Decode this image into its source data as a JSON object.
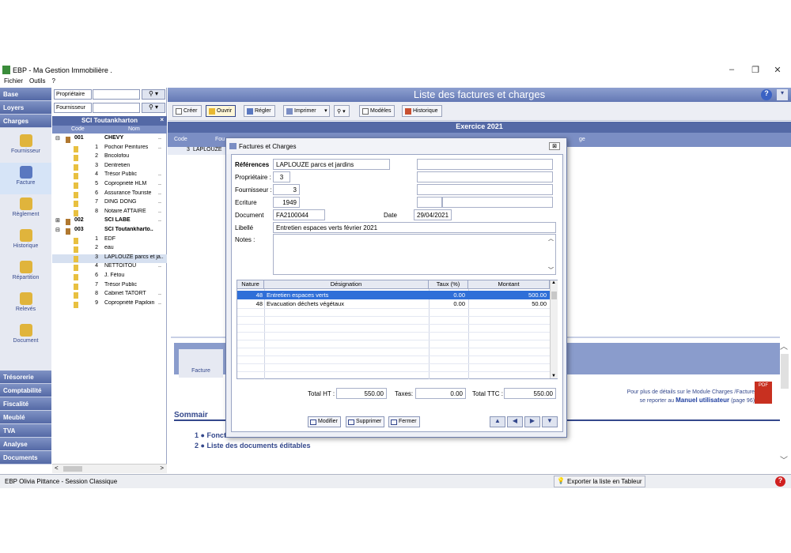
{
  "window": {
    "title": "EBP - Ma Gestion Immobilière .",
    "min": "–",
    "max": "❐",
    "close": "✕"
  },
  "menu": [
    "Fichier",
    "Outils",
    "?"
  ],
  "leftnav": {
    "top_groups": [
      "Base",
      "Loyers",
      "Charges"
    ],
    "items": [
      "Fournisseur",
      "Facture",
      "Règlement",
      "Historique",
      "Répartition",
      "Relevés",
      "Document"
    ],
    "bottom_groups": [
      "Trésorerie",
      "Comptabilité",
      "Fiscalité",
      "Meublé",
      "TVA",
      "Analyse",
      "Documents"
    ]
  },
  "filters": [
    {
      "label": "Propriétaire",
      "btn": "⚲ ▾"
    },
    {
      "label": "Fournisseur",
      "btn": "⚲ ▾"
    }
  ],
  "tree": {
    "header": "SCI Toutankharton",
    "close": "×",
    "col_code": "Code",
    "col_nom": "Nom",
    "rows": [
      {
        "t": "grp",
        "exp": "⊟",
        "code": "001",
        "nom": "CHEVY",
        "x": ".."
      },
      {
        "t": "item",
        "code": "1",
        "nom": "Pochoir Peintures",
        "x": ".."
      },
      {
        "t": "item",
        "code": "2",
        "nom": "Bricolofou",
        "x": ""
      },
      {
        "t": "item",
        "code": "3",
        "nom": "Dentretien",
        "x": ""
      },
      {
        "t": "item",
        "code": "4",
        "nom": "Trésor Public",
        "x": ".."
      },
      {
        "t": "item",
        "code": "5",
        "nom": "Copropriété HLM",
        "x": ".."
      },
      {
        "t": "item",
        "code": "6",
        "nom": "Assurance Touriste",
        "x": ".."
      },
      {
        "t": "item",
        "code": "7",
        "nom": "DING DONG",
        "x": ".."
      },
      {
        "t": "item",
        "code": "8",
        "nom": "Notaire ATTAIRE",
        "x": ".."
      },
      {
        "t": "grp",
        "exp": "⊞",
        "code": "002",
        "nom": "SCI LABE",
        "x": ".."
      },
      {
        "t": "grp",
        "exp": "⊟",
        "code": "003",
        "nom": "SCI Toutankharto..",
        "x": ""
      },
      {
        "t": "item",
        "code": "1",
        "nom": "EDF",
        "x": ""
      },
      {
        "t": "item",
        "code": "2",
        "nom": "eau",
        "x": ""
      },
      {
        "t": "item",
        "code": "3",
        "nom": "LAPLOUZE parcs et ja..",
        "x": "",
        "sel": true
      },
      {
        "t": "item",
        "code": "4",
        "nom": "NETTOITOU",
        "x": ".."
      },
      {
        "t": "item",
        "code": "6",
        "nom": "J. Fétou",
        "x": ""
      },
      {
        "t": "item",
        "code": "7",
        "nom": "Trésor Public",
        "x": ""
      },
      {
        "t": "item",
        "code": "8",
        "nom": "Cabinet TATORT",
        "x": ".."
      },
      {
        "t": "item",
        "code": "9",
        "nom": "Copropriété Papiloin",
        "x": ".."
      }
    ]
  },
  "main": {
    "title": "Liste des factures et charges",
    "help": "?",
    "toolbar": [
      "Créer",
      "Ouvrir",
      "Régler",
      "Imprimer",
      "Modèles",
      "Historique"
    ],
    "exercice": "Exercice 2021",
    "list_col1": "Code",
    "list_col2": "Fou",
    "list_col_right": "ge",
    "list_row_code": "3",
    "list_row_name": "LAPLOUZE",
    "facture_label": "Facture",
    "note_line1": "Pour plus de détails sur le Module Charges /Facture,",
    "note_line2a": "se reporter au",
    "note_link": "Manuel utilisateur",
    "note_line2b": "(page 96).",
    "pdf": "PDF",
    "sommaire": "Sommair",
    "link1": "1 ● Fonct",
    "link2": "2 ● Liste des documents éditables"
  },
  "dialog": {
    "title": "Factures et Charges",
    "close": "⊠",
    "references_label": "Références",
    "references": "LAPLOUZE parcs et jardins",
    "proprietaire_label": "Propriétaire :",
    "proprietaire": "3",
    "fournisseur_label": "Fournisseur :",
    "fournisseur": "3",
    "ecriture_label": "Ecriture",
    "ecriture": "1949",
    "document_label": "Document",
    "document": "FA2100044",
    "date_label": "Date",
    "date": "29/04/2021",
    "libelle_label": "Libellé",
    "libelle": "Entretien espaces verts février 2021",
    "notes_label": "Notes :",
    "grid_headers": [
      "Nature",
      "Désignation",
      "Taux (%)",
      "Montant"
    ],
    "grid_rows": [
      {
        "nature": "48",
        "designation": "Entretien espaces verts",
        "taux": "0.00",
        "montant": "500.00"
      },
      {
        "nature": "48",
        "designation": "Evacuation déchets végétaux",
        "taux": "0.00",
        "montant": "50.00"
      }
    ],
    "total_ht_label": "Total HT :",
    "total_ht": "550.00",
    "taxes_label": "Taxes:",
    "taxes": "0.00",
    "total_ttc_label": "Total TTC :",
    "total_ttc": "550.00",
    "btn_modifier": "Modifier",
    "btn_supprimer": "Supprimer",
    "btn_fermer": "Fermer",
    "nav": [
      "▲",
      "◀",
      "▶",
      "▼"
    ]
  },
  "status": {
    "text": "EBP Olivia Pittance - Session Classique",
    "export": "Exporter la liste en Tableur",
    "help": "?"
  }
}
